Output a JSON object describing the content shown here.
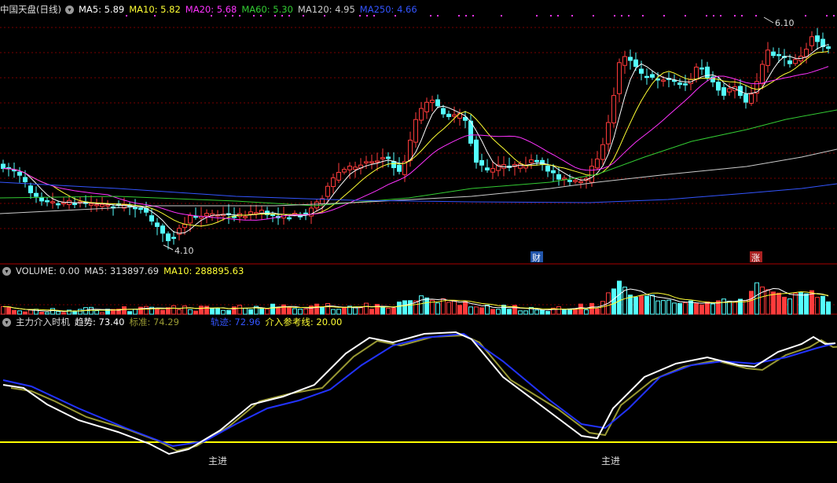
{
  "colors": {
    "up": "#ff3b3b",
    "down": "#54ffff",
    "ma5": "#ffffff",
    "ma10": "#ffff33",
    "ma20": "#ff33ff",
    "ma60": "#33cc33",
    "ma120": "#cccccc",
    "ma250": "#3355ff",
    "grid": "#7a0000",
    "trend": "#ffffff",
    "std": "#999933",
    "track": "#2233ff",
    "ref": "#ffff00",
    "divider": "#aa0000"
  },
  "price_panel": {
    "title": "中国天盘(日线)",
    "ma": [
      {
        "label": "MA5: 5.89",
        "color": "#ffffff"
      },
      {
        "label": "MA10: 5.82",
        "color": "#ffff33"
      },
      {
        "label": "MA20: 5.68",
        "color": "#ff33ff"
      },
      {
        "label": "MA60: 5.30",
        "color": "#33cc33"
      },
      {
        "label": "MA120: 4.95",
        "color": "#cccccc"
      },
      {
        "label": "MA250: 4.66",
        "color": "#3355ff"
      }
    ],
    "high_label": "6.10",
    "low_label": "4.10",
    "marker_cai": "财",
    "marker_zhang": "涨"
  },
  "volume_panel": {
    "label": "VOLUME: 0.00",
    "ma5": "MA5: 313897.69",
    "ma10": "MA10: 288895.63"
  },
  "indicator_panel": {
    "title": "主力介入时机",
    "trend": "趋势: 73.40",
    "std": "标准: 74.29",
    "track": "轨迹: 72.96",
    "ref": "介入参考线: 20.00",
    "signal": "主进"
  },
  "chart_data": [
    {
      "type": "line",
      "title": "中国天盘(日线)",
      "y_range": [
        4.1,
        6.1
      ],
      "series": [
        {
          "name": "MA5",
          "last": 5.89
        },
        {
          "name": "MA10",
          "last": 5.82
        },
        {
          "name": "MA20",
          "last": 5.68
        },
        {
          "name": "MA60",
          "last": 5.3
        },
        {
          "name": "MA120",
          "last": 4.95
        },
        {
          "name": "MA250",
          "last": 4.66
        }
      ],
      "annotations": [
        "6.10",
        "4.10",
        "财",
        "涨"
      ]
    },
    {
      "type": "bar",
      "title": "VOLUME",
      "series": [
        {
          "name": "VOLUME",
          "last": 0.0
        },
        {
          "name": "MA5",
          "last": 313897.69
        },
        {
          "name": "MA10",
          "last": 288895.63
        }
      ]
    },
    {
      "type": "line",
      "title": "主力介入时机",
      "series": [
        {
          "name": "趋势",
          "last": 73.4
        },
        {
          "name": "标准",
          "last": 74.29
        },
        {
          "name": "轨迹",
          "last": 72.96
        },
        {
          "name": "介入参考线",
          "last": 20.0
        }
      ],
      "annotations": [
        "主进",
        "主进"
      ]
    }
  ]
}
